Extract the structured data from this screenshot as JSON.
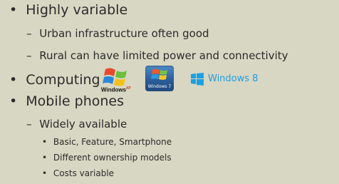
{
  "bullets": [
    {
      "text": "Highly variable"
    },
    {
      "text": "Urban infrastructure often good"
    },
    {
      "text": "Rural can have limited power and connectivity"
    },
    {
      "text": "Computing"
    },
    {
      "text": "Mobile phones"
    },
    {
      "text": "Widely available"
    },
    {
      "text": "Basic, Feature, Smartphone"
    },
    {
      "text": "Different ownership models"
    },
    {
      "text": "Costs variable"
    }
  ],
  "markers": {
    "level1": "•",
    "level2": "–",
    "level3": "•"
  },
  "logos": {
    "xp_label": "Windows",
    "xp_sup": "XP",
    "win7_label": "Windows 7",
    "win8_label": "Windows 8"
  },
  "colors": {
    "background": "#d8d7c3",
    "text": "#2b2b2b",
    "windows8_accent": "#1ba1e2"
  }
}
